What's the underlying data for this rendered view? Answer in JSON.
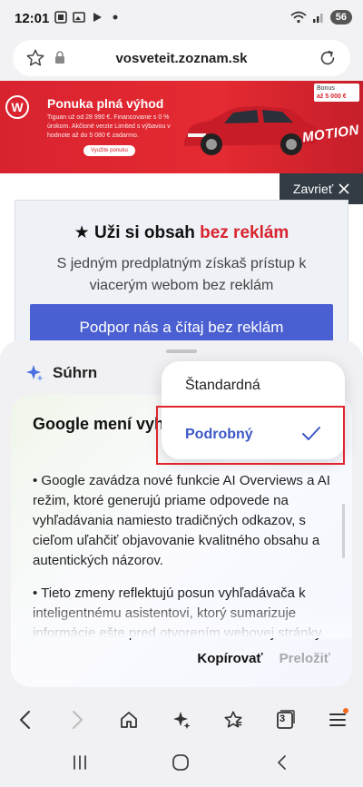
{
  "status_bar": {
    "time": "12:01",
    "battery": "56",
    "icons": [
      "scan-icon",
      "gallery-icon",
      "play-icon",
      "dot-icon",
      "wifi-icon",
      "signal-icon"
    ]
  },
  "browser": {
    "url": "vosveteit.zoznam.sk"
  },
  "ad": {
    "title": "Ponuka plná výhod",
    "text": "Tiguan už od 28 990 €. Financovanie s 0 % úrokom. Akčioné verzie Limited s výbavou v hodnote až do 5 080 € zadarmo.",
    "cta": "Využite ponuku",
    "bonus_label": "Bonus",
    "bonus_value": "až 5 000 €",
    "tagline": "MOTION"
  },
  "close_ad": {
    "label": "Zavrieť"
  },
  "promo": {
    "title_prefix": "Uži si obsah ",
    "title_highlight": "bez reklám",
    "subtitle": "S jedným predplatným získaš prístup k viacerým webom bez reklám",
    "button": "Podpor nás a čítaj bez reklám"
  },
  "summary": {
    "header": "Súhrn",
    "title": "Google mení vyhľ Nové funkcie a ich",
    "paragraphs": [
      "• Google zavádza nové funkcie AI Overviews a AI režim, ktoré generujú priame odpovede na vyhľadávania namiesto tradičných odkazov, s cieľom uľahčiť objavovanie kvalitného obsahu a autentických názorov.",
      "• Tieto zmeny reflektujú posun vyhľadávača k inteligentnému asistentovi, ktorý sumarizuje informácie ešte pred otvorením webovej stránky."
    ],
    "copy": "Kopírovať",
    "translate": "Preložiť"
  },
  "dropdown": {
    "options": [
      {
        "label": "Štandardná",
        "selected": false
      },
      {
        "label": "Podrobný",
        "selected": true
      }
    ]
  },
  "toolbar": {
    "tab_count": "3"
  },
  "colors": {
    "accent": "#3c59c6",
    "promo_button": "#4a5fd1",
    "highlight_red": "#e0242b",
    "ad_red": "#d8232f"
  }
}
